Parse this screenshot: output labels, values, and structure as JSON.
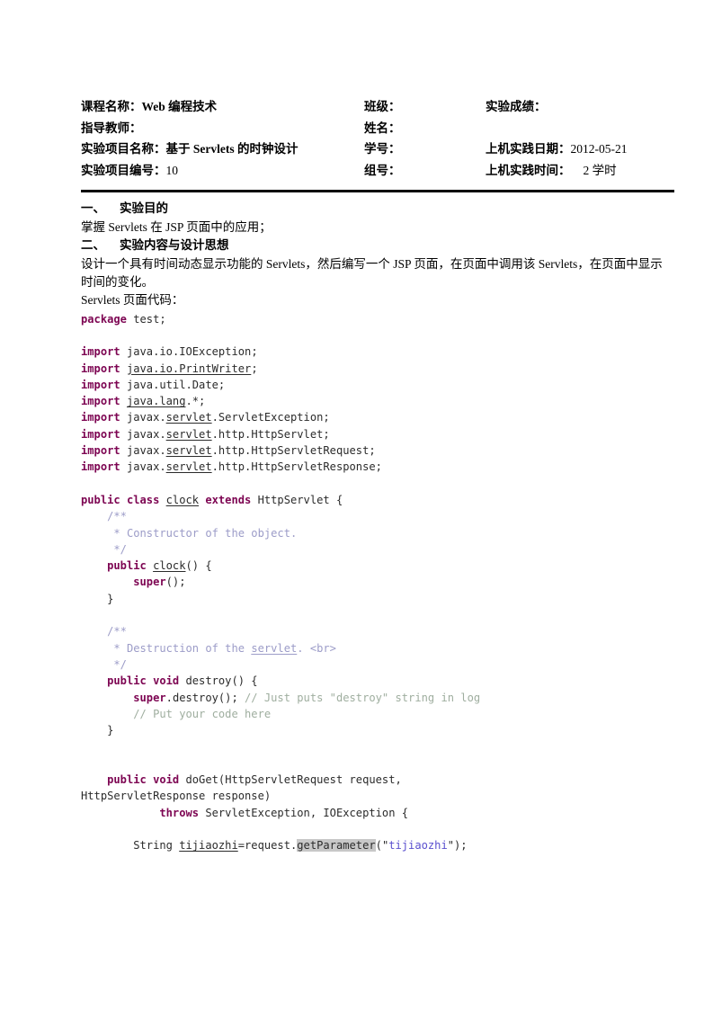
{
  "document": {
    "header": {
      "rows": [
        {
          "c1_label": "课程名称：",
          "c1_value": "Web 编程技术",
          "c2_label": "班级：",
          "c2_value": "",
          "c3_label": "实验成绩：",
          "c3_value": ""
        },
        {
          "c1_label": "指导教师：",
          "c1_value": "",
          "c2_label": "姓名：",
          "c2_value": "",
          "c3_label": "",
          "c3_value": ""
        },
        {
          "c1_label": "实验项目名称：",
          "c1_value": "基于 Servlets 的时钟设计",
          "c2_label": "学号：",
          "c2_value": "",
          "c3_label": "上机实践日期：",
          "c3_value": "2012-05-21"
        },
        {
          "c1_label": "实验项目编号：",
          "c1_value": "10",
          "c2_label": "组号：",
          "c2_value": "",
          "c3_label": "上机实践时间：",
          "c3_value": "2 学时"
        }
      ]
    },
    "sections": [
      {
        "number": "一、",
        "title": "实验目的",
        "paragraphs": [
          "掌握 Servlets 在 JSP 页面中的应用；"
        ]
      },
      {
        "number": "二、",
        "title": "实验内容与设计思想",
        "paragraphs": [
          "设计一个具有时间动态显示功能的 Servlets，然后编写一个 JSP 页面，在页面中调用该 Servlets，在页面中显示时间的变化。",
          "Servlets 页面代码："
        ]
      }
    ],
    "code": {
      "language": "java",
      "lines": [
        "package test;",
        "",
        "import java.io.IOException;",
        "import java.io.PrintWriter;",
        "import java.util.Date;",
        "import java.lang.*;",
        "import javax.servlet.ServletException;",
        "import javax.servlet.http.HttpServlet;",
        "import javax.servlet.http.HttpServletRequest;",
        "import javax.servlet.http.HttpServletResponse;",
        "",
        "public class clock extends HttpServlet {",
        "    /**",
        "     * Constructor of the object.",
        "     */",
        "    public clock() {",
        "        super();",
        "    }",
        "",
        "    /**",
        "     * Destruction of the servlet. <br>",
        "     */",
        "    public void destroy() {",
        "        super.destroy(); // Just puts \"destroy\" string in log",
        "        // Put your code here",
        "    }",
        "",
        "",
        "    public void doGet(HttpServletRequest request,",
        "HttpServletResponse response)",
        "            throws ServletException, IOException {",
        "",
        "        String tijiaozhi=request.getParameter(\"tijiaozhi\");"
      ]
    },
    "colors": {
      "keyword": "#7d0552",
      "javadoc_comment": "#9c9cc8",
      "line_comment": "#9fae9f",
      "string_literal": "#5a4fcf",
      "highlight_background": "#c8c8c8",
      "rule": "#000000"
    }
  }
}
